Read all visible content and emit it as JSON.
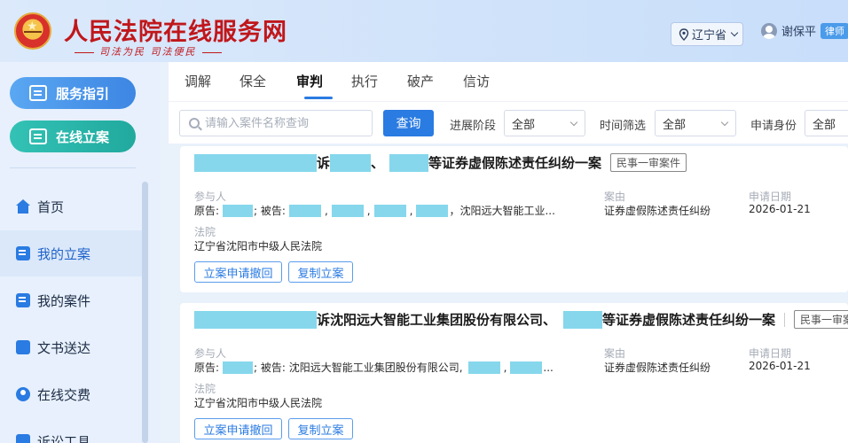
{
  "header": {
    "site_title": "人民法院在线服务网",
    "slogan": "司法为民  司法便民",
    "region": "辽宁省",
    "user_name": "谢保平",
    "role_badge": "律师"
  },
  "sidebar": {
    "primary_buttons": [
      {
        "label": "服务指引",
        "icon": "guide-icon"
      },
      {
        "label": "在线立案",
        "icon": "file-edit-icon"
      }
    ],
    "items": [
      {
        "label": "首页",
        "icon": "home-icon"
      },
      {
        "label": "我的立案",
        "icon": "edit-doc-icon",
        "active": true
      },
      {
        "label": "我的案件",
        "icon": "case-doc-icon"
      },
      {
        "label": "文书送达",
        "icon": "delivery-icon"
      },
      {
        "label": "在线交费",
        "icon": "payment-icon"
      },
      {
        "label": "诉讼工具",
        "icon": "tools-icon"
      }
    ]
  },
  "tabs": [
    {
      "label": "调解"
    },
    {
      "label": "保全"
    },
    {
      "label": "审判",
      "active": true
    },
    {
      "label": "执行"
    },
    {
      "label": "破产"
    },
    {
      "label": "信访"
    }
  ],
  "filters": {
    "search_placeholder": "请输入案件名称查询",
    "query_button": "查询",
    "stage_label": "进展阶段",
    "stage_value": "全部",
    "time_label": "时间筛选",
    "time_value": "全部",
    "identity_label": "申请身份",
    "identity_value": "全部"
  },
  "cases": [
    {
      "title_part1": "诉",
      "title_part2": "、",
      "title_part3": "等证券虚假陈述责任纠纷一案",
      "case_type": "民事一审案件",
      "participants_label": "参与人",
      "plaintiff_prefix": "原告:",
      "defendant_prefix": "; 被告:",
      "defendant_tail": "，沈阳远大智能工业...",
      "cause_label": "案由",
      "cause_value": "证券虚假陈述责任纠纷",
      "date_label": "申请日期",
      "date_value": "2026-01-21",
      "court_label": "法院",
      "court_value": "辽宁省沈阳市中级人民法院",
      "withdraw_button": "立案申请撤回",
      "copy_button": "复制立案"
    },
    {
      "title_part1": "诉沈阳远大智能工业集团股份有限公司、",
      "title_part2": "",
      "title_part3": "等证券虚假陈述责任纠纷一案",
      "case_type": "民事一审案件",
      "participants_label": "参与人",
      "plaintiff_prefix": "原告:",
      "defendant_prefix": "; 被告: 沈阳远大智能工业集团股份有限公司,",
      "defendant_tail": "...",
      "cause_label": "案由",
      "cause_value": "证券虚假陈述责任纠纷",
      "date_label": "申请日期",
      "date_value": "2026-01-21",
      "court_label": "法院",
      "court_value": "辽宁省沈阳市中级人民法院",
      "withdraw_button": "立案申请撤回",
      "copy_button": "复制立案"
    }
  ],
  "colors": {
    "brand_red": "#c0171b",
    "accent_blue": "#2a7be2",
    "teal": "#21a99e",
    "redaction": "#86d7ec"
  }
}
